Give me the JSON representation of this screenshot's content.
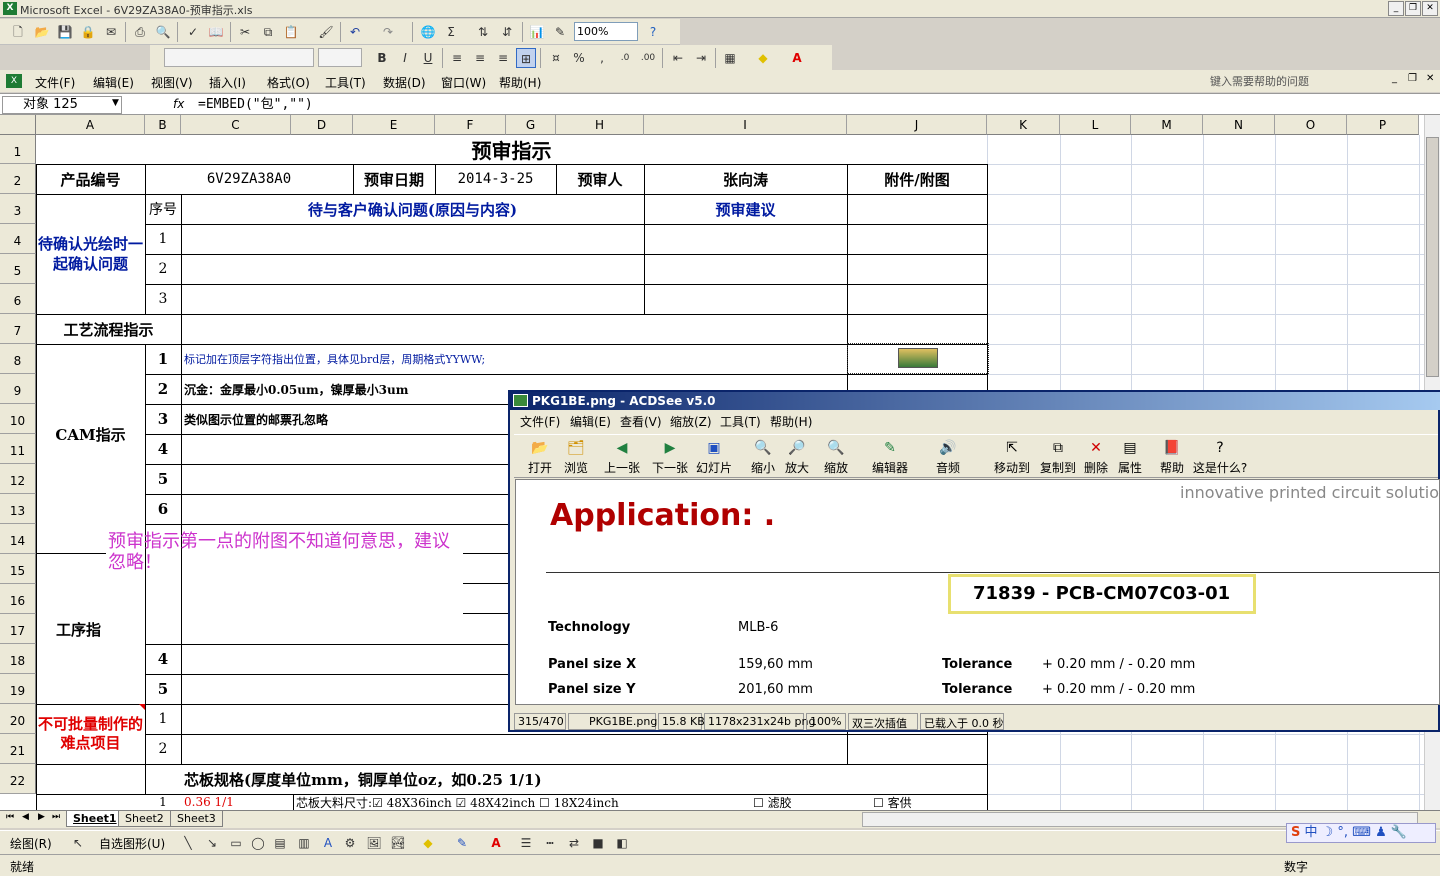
{
  "window": {
    "title": "Microsoft Excel - 6V29ZA38A0-预审指示.xls",
    "app_icon": "X"
  },
  "toolbar": {
    "zoom": "100%",
    "help_prompt": "键入需要帮助的问题"
  },
  "menu": [
    "文件(F)",
    "编辑(E)",
    "视图(V)",
    "插入(I)",
    "格式(O)",
    "工具(T)",
    "数据(D)",
    "窗口(W)",
    "帮助(H)"
  ],
  "formula_bar": {
    "name_box": "对象 125",
    "fx": "fx",
    "formula": "=EMBED(\"包\",\"\")"
  },
  "columns": [
    "A",
    "B",
    "C",
    "D",
    "E",
    "F",
    "G",
    "H",
    "I",
    "J",
    "K",
    "L",
    "M",
    "N",
    "O",
    "P"
  ],
  "rows": [
    "1",
    "2",
    "3",
    "4",
    "5",
    "6",
    "7",
    "8",
    "9",
    "10",
    "11",
    "12",
    "13",
    "14",
    "15",
    "16",
    "17",
    "18",
    "19",
    "20",
    "21",
    "22"
  ],
  "sheet": {
    "title": "预审指示",
    "product_label": "产品编号",
    "product_value": "6V29ZA38A0",
    "date_label": "预审日期",
    "date_value": "2014-3-25",
    "reviewer_label": "预审人",
    "reviewer_value": "张向涛",
    "attach_label": "附件/附图",
    "seq_label": "序号",
    "confirm_header": "待与客户确认问题(原因与内容)",
    "advice_header": "预审建议",
    "confirm_section": "待确认光绘时一起确认问题",
    "seq_1": "1",
    "seq_2": "2",
    "seq_3": "3",
    "seq_4": "4",
    "seq_5": "5",
    "seq_6": "6",
    "process_label": "工艺流程指示",
    "cam_label": "CAM指示",
    "cam_1": "标记加在顶层字符指出位置，具体见brd层，周期格式YYWW;",
    "cam_2": "沉金：金厚最小0.05um，镍厚最小3um",
    "cam_3": "类似图示位置的邮票孔忽略",
    "comment": "预审指示第一点的附图不知道何意思，建议忽略！",
    "step_label": "工序指",
    "hard_label": "不可批量制作的难点项目",
    "core_spec": "芯板规格(厚度单位mm，铜厚单位oz，如0.25 1/1)",
    "core_spec_unit_mm": "mm",
    "core_spec_unit_oz": "oz",
    "core_spec_example": "0.25 1/1",
    "row23_val": "0.36 1/1",
    "row23_text": "芯板大料尺寸:☑ 48X36inch ☑ 48X42inch ☐ 18X24inch",
    "row23_extra1": "☐ 滤胶",
    "row23_extra2": "☐ 客供"
  },
  "acdsee": {
    "title": "PKG1BE.png - ACDSee v5.0",
    "menu": [
      "文件(F)",
      "编辑(E)",
      "查看(V)",
      "缩放(Z)",
      "工具(T)",
      "帮助(H)"
    ],
    "tools": [
      "打开",
      "浏览",
      "上一张",
      "下一张",
      "幻灯片",
      "缩小",
      "放大",
      "缩放",
      "编辑器",
      "音频",
      "移动到",
      "复制到",
      "删除",
      "属性",
      "帮助",
      "这是什么?"
    ],
    "image": {
      "tagline": "innovative printed circuit solutions",
      "application": "Application: .",
      "part_number": "71839 - PCB-CM07C03-01",
      "tech_label": "Technology",
      "tech_value": "MLB-6",
      "panel_x_label": "Panel size X",
      "panel_x_value": "159,60 mm",
      "panel_y_label": "Panel size Y",
      "panel_y_value": "201,60 mm",
      "tol_label": "Tolerance",
      "tol_value": "+ 0.20 mm / - 0.20 mm"
    },
    "status": [
      "315/470",
      "PKG1BE.png",
      "15.8 KB",
      "1178x231x24b png",
      "100%",
      "双三次插值",
      "已载入于 0.0 秒"
    ]
  },
  "sheet_tabs": [
    "Sheet1",
    "Sheet2",
    "Sheet3"
  ],
  "drawing": {
    "draw": "绘图(R)",
    "autoshapes": "自选图形(U)"
  },
  "status": {
    "left": "就绪",
    "right": "数字"
  },
  "colors": {
    "blue_text": "#001aa0",
    "red_text": "#e00000",
    "comment": "#cc33cc",
    "acdsee_red": "#b00000"
  }
}
